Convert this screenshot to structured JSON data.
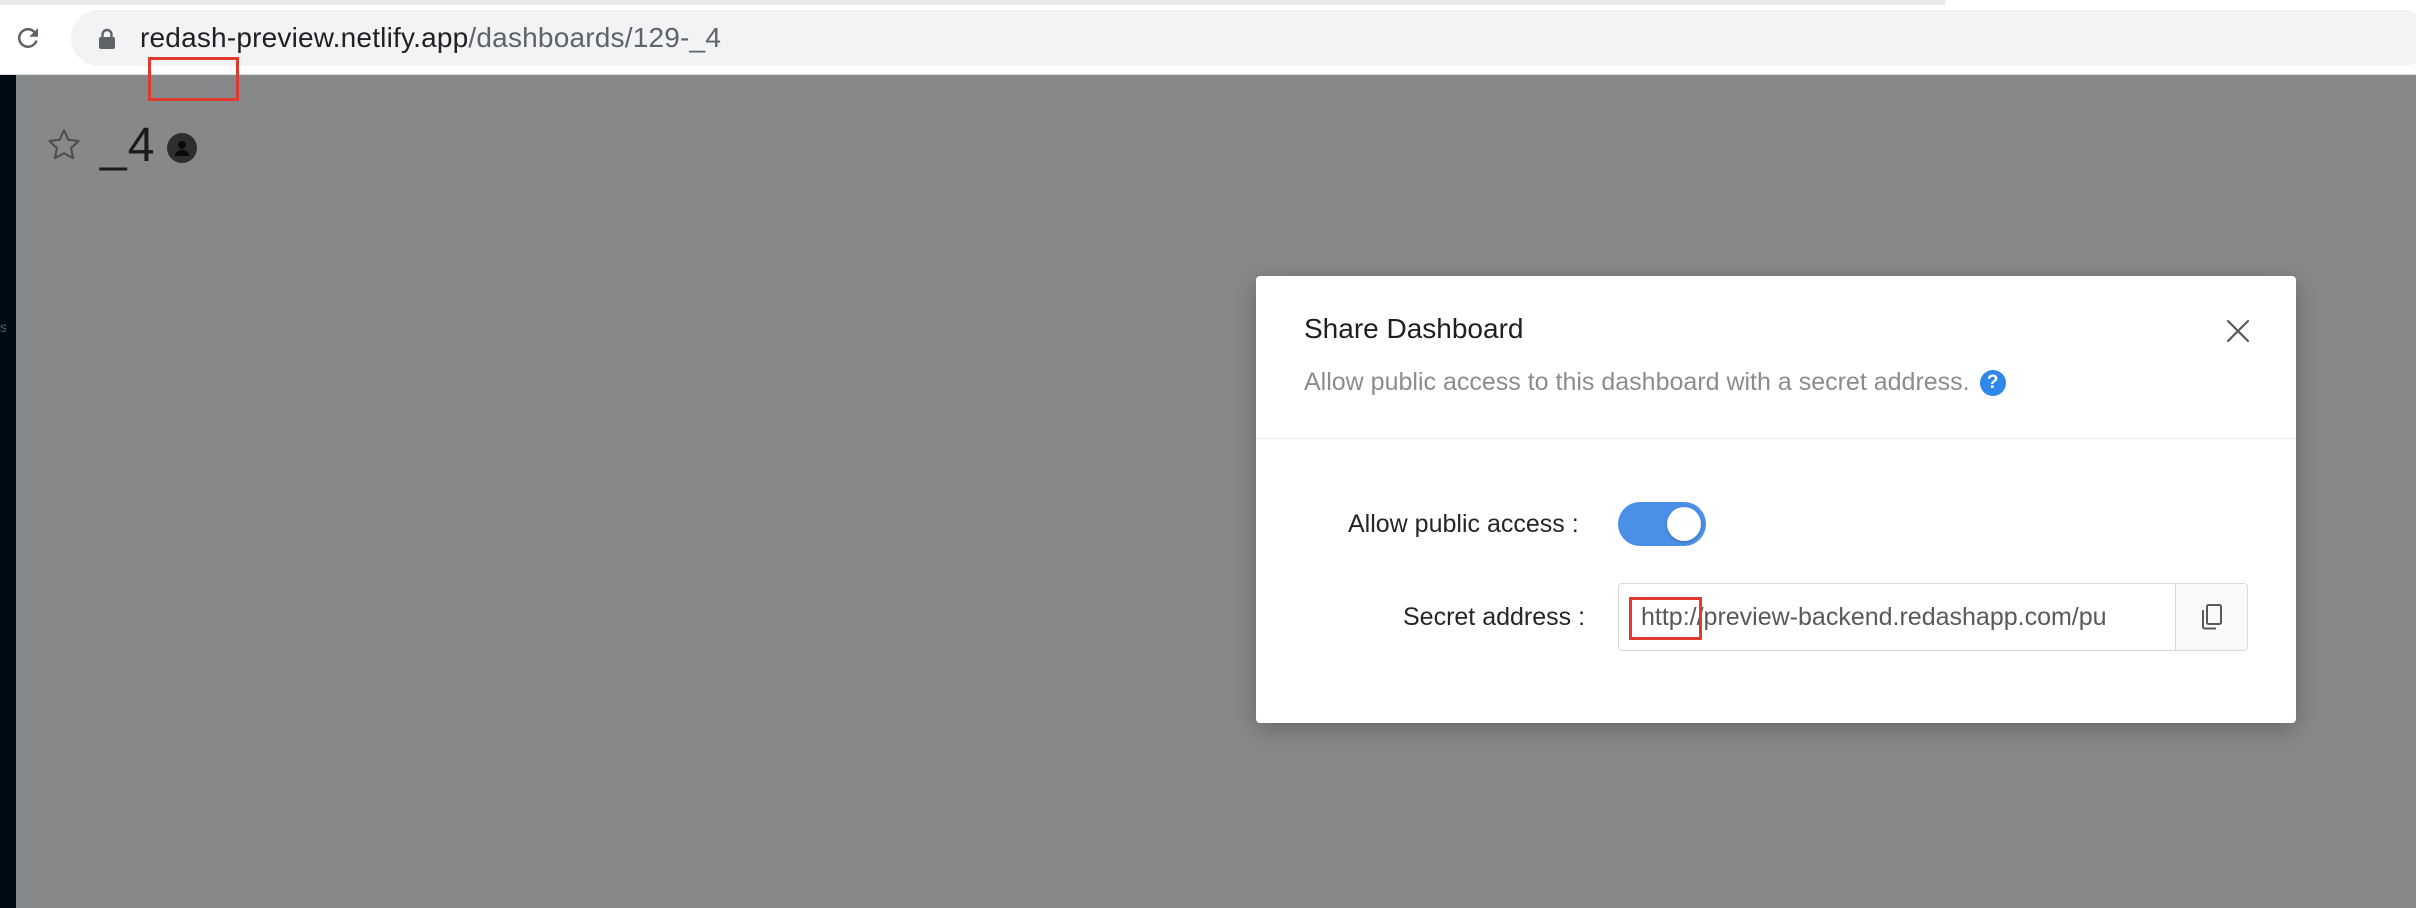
{
  "browser": {
    "url_host": "redash-preview.netlify.app",
    "url_path": "/dashboards/129-_4"
  },
  "dashboard": {
    "title": "_4"
  },
  "left_nav": {
    "glyph": "s"
  },
  "modal": {
    "title": "Share Dashboard",
    "description": "Allow public access to this dashboard with a secret address.",
    "help_glyph": "?",
    "public_access_label": "Allow public access",
    "public_access_enabled": true,
    "secret_address_label": "Secret address",
    "secret_address_value": "http://preview-backend.redashapp.com/pu"
  },
  "colors": {
    "toggle_on": "#4a90e9",
    "help_icon": "#2f86eb",
    "highlight_box": "#e03a2f"
  }
}
